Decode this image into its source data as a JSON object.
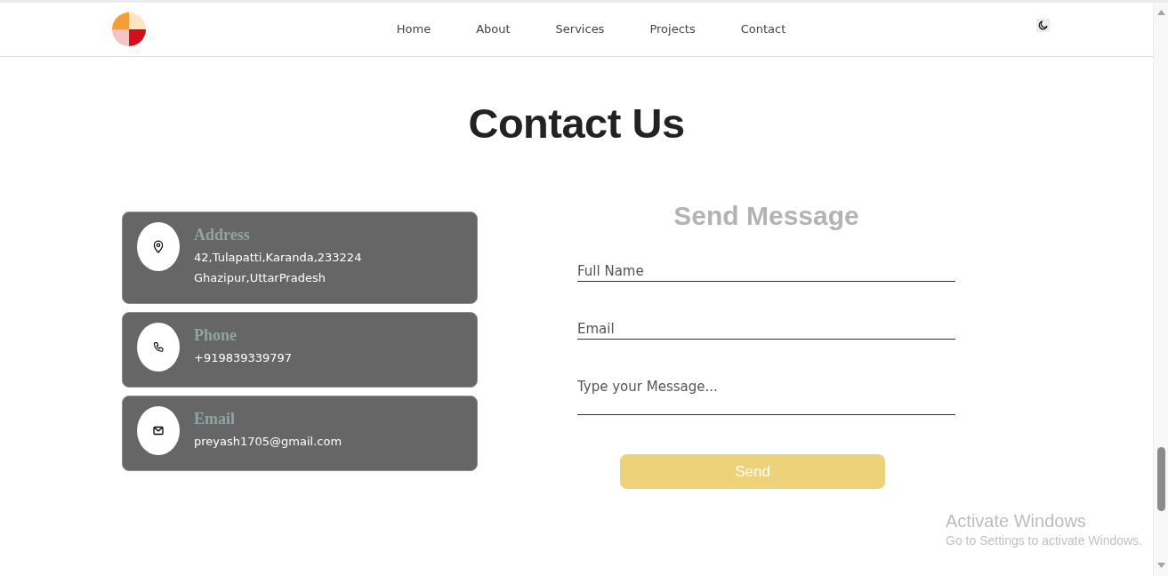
{
  "navbar": {
    "links": [
      "Home",
      "About",
      "Services",
      "Projects",
      "Contact"
    ]
  },
  "page": {
    "title": "Contact Us"
  },
  "contact_cards": [
    {
      "kind": "address",
      "heading": "Address",
      "lines": [
        "42,Tulapatti,Karanda,233224",
        "Ghazipur,UttarPradesh"
      ]
    },
    {
      "kind": "phone",
      "heading": "Phone",
      "lines": [
        "+919839339797"
      ]
    },
    {
      "kind": "email",
      "heading": "Email",
      "lines": [
        "preyash1705@gmail.com"
      ]
    }
  ],
  "form": {
    "title": "Send Message",
    "fields": [
      {
        "kind": "input",
        "placeholder": "Full Name"
      },
      {
        "kind": "input",
        "placeholder": "Email"
      },
      {
        "kind": "textarea",
        "placeholder": "Type your Message..."
      }
    ],
    "submit": "Send"
  },
  "os_overlay": {
    "title": "Activate Windows",
    "subtitle": "Go to Settings to activate Windows."
  }
}
